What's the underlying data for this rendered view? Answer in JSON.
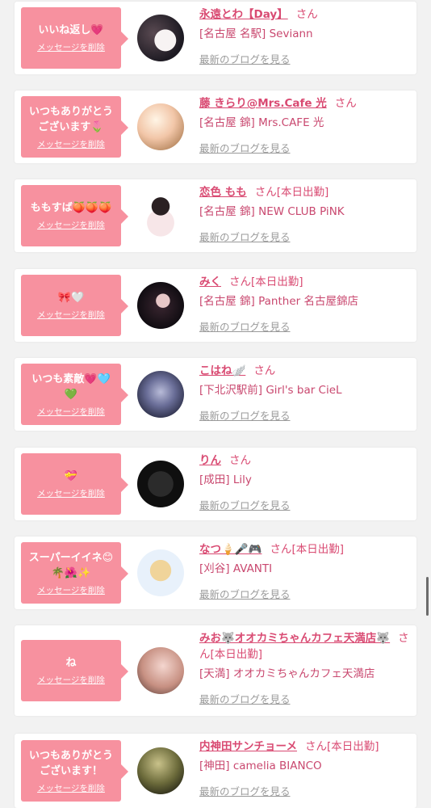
{
  "delete_label": "メッセージを削除",
  "blog_label": "最新のブログを見る",
  "san_label": "さん",
  "colors": {
    "bubble": "#f7919f",
    "name": "#d94a72",
    "link": "#9a9a9a"
  },
  "items": [
    {
      "message": "いいね返し💗",
      "name": "永遠とわ【Day】",
      "suffix": "",
      "shop": "[名古屋 名駅] Seviann",
      "avatar": "a1"
    },
    {
      "message": "いつもありがとう\nございます🌷",
      "name": "藤 きらり@Mrs.Cafe 光",
      "suffix": "",
      "shop": "[名古屋 錦] Mrs.CAFE 光",
      "avatar": "a2"
    },
    {
      "message": "ももすば🍑🍑🍑",
      "name": "恋色 もも",
      "suffix": "[本日出勤]",
      "shop": "[名古屋 錦] NEW CLUB PiNK",
      "avatar": "a3"
    },
    {
      "message": "🎀🤍",
      "name": "みく",
      "suffix": "[本日出勤]",
      "shop": "[名古屋 錦] Panther 名古屋錦店",
      "avatar": "a4"
    },
    {
      "message": "いつも素敵💗🩵\n💚",
      "name": "こはね🪽",
      "suffix": "",
      "shop": "[下北沢駅前] Girl's bar CieL",
      "avatar": "a5"
    },
    {
      "message": "💝",
      "name": "りん",
      "suffix": "",
      "shop": "[成田] Lily",
      "avatar": "a6"
    },
    {
      "message": "スーパーイイネ😊\n🌴🌺✨",
      "name": "なつ🍦🎤🎮",
      "suffix": "[本日出勤]",
      "shop": "[刈谷] AVANTI",
      "avatar": "a7"
    },
    {
      "message": "ね",
      "name": "みお🐺オオカミちゃんカフェ天満店🐺",
      "suffix": "[本日出勤]",
      "shop": "[天満] オオカミちゃんカフェ天満店",
      "avatar": "a8"
    },
    {
      "message": "いつもありがとう\nございます！",
      "name": "内神田サンチョーメ",
      "suffix": "[本日出勤]",
      "shop": "[神田] camelia BIANCO",
      "avatar": "a9"
    }
  ]
}
